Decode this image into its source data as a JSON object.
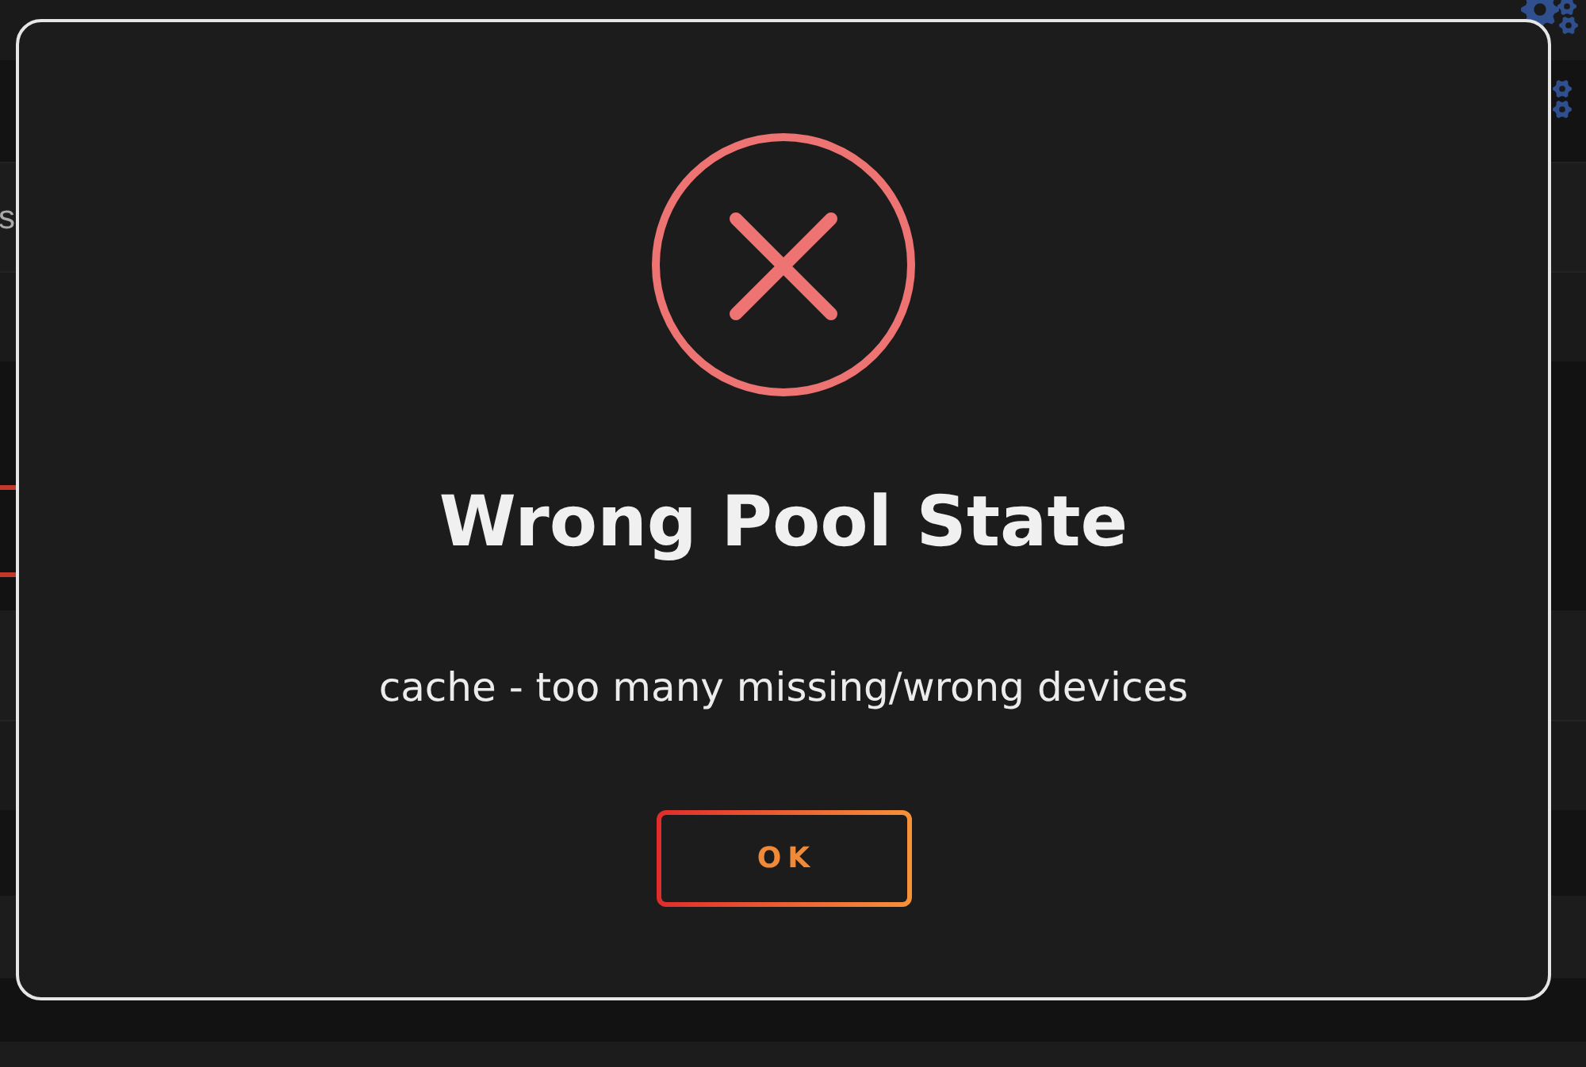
{
  "background": {
    "row_label": "s"
  },
  "dialog": {
    "kind": "error",
    "title": "Wrong Pool State",
    "message": "cache - too many missing/wrong devices",
    "buttons": [
      {
        "label": "OK"
      }
    ]
  }
}
